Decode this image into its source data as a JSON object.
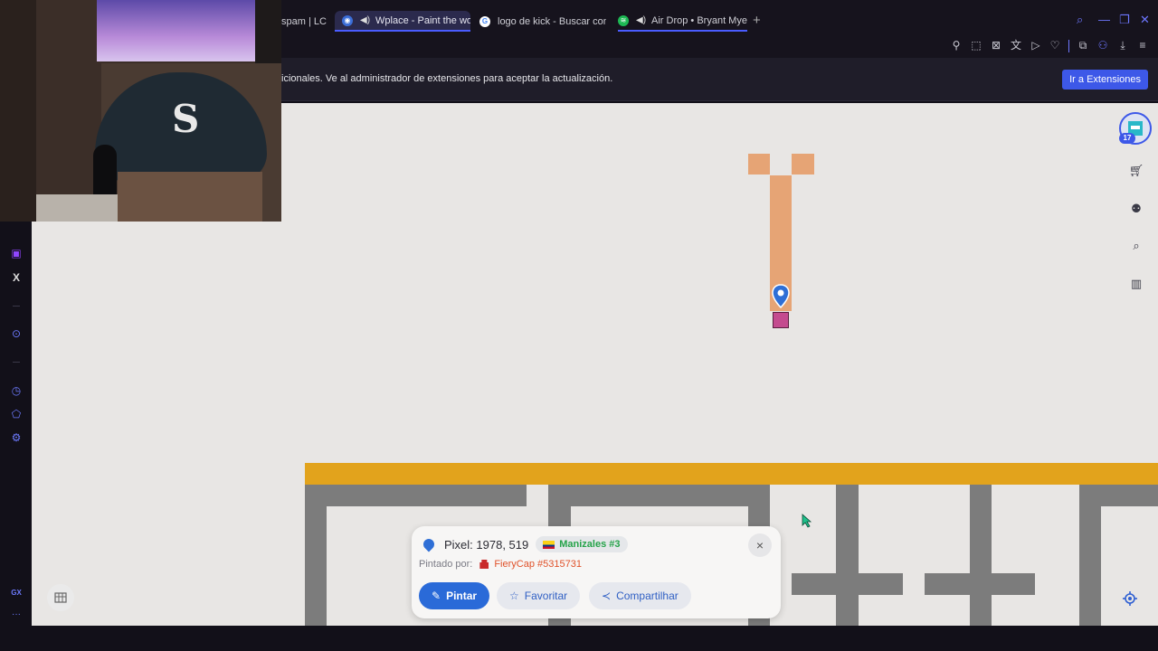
{
  "tabs": [
    {
      "label": "spam | LC",
      "active": false
    },
    {
      "label": "Wplace - Paint the wo",
      "active": true,
      "audio": true
    },
    {
      "label": "logo de kick - Buscar con",
      "active": false
    },
    {
      "label": "Air Drop • Bryant Mye",
      "active": false,
      "audio": true
    }
  ],
  "new_tab": "+",
  "notification": {
    "text": "icionales. Ve al administrador de extensiones para aceptar la actualización.",
    "button": "Ir a Extensiones"
  },
  "sidebar": {
    "twitch_icon": "twitch-icon",
    "x_label": "X",
    "gx_label": "GX",
    "more_label": "···"
  },
  "user_badge": "17",
  "popup": {
    "pixel_label": "Pixel: 1978, 519",
    "region": "Manizales #3",
    "painted_by_label": "Pintado por:",
    "painter": "FieryCap #5315731",
    "paint_button": "Pintar",
    "favorite_button": "Favoritar",
    "share_button": "Compartilhar",
    "close": "×"
  },
  "colors": {
    "accent": "#2a6ad8",
    "tab_active": "#2b2a4d",
    "canvas_bg": "#e8e6e4",
    "orange_bar": "#e2a31c",
    "wall": "#7c7c7c",
    "peach": "#e6a475",
    "magenta": "#c44b8f"
  }
}
